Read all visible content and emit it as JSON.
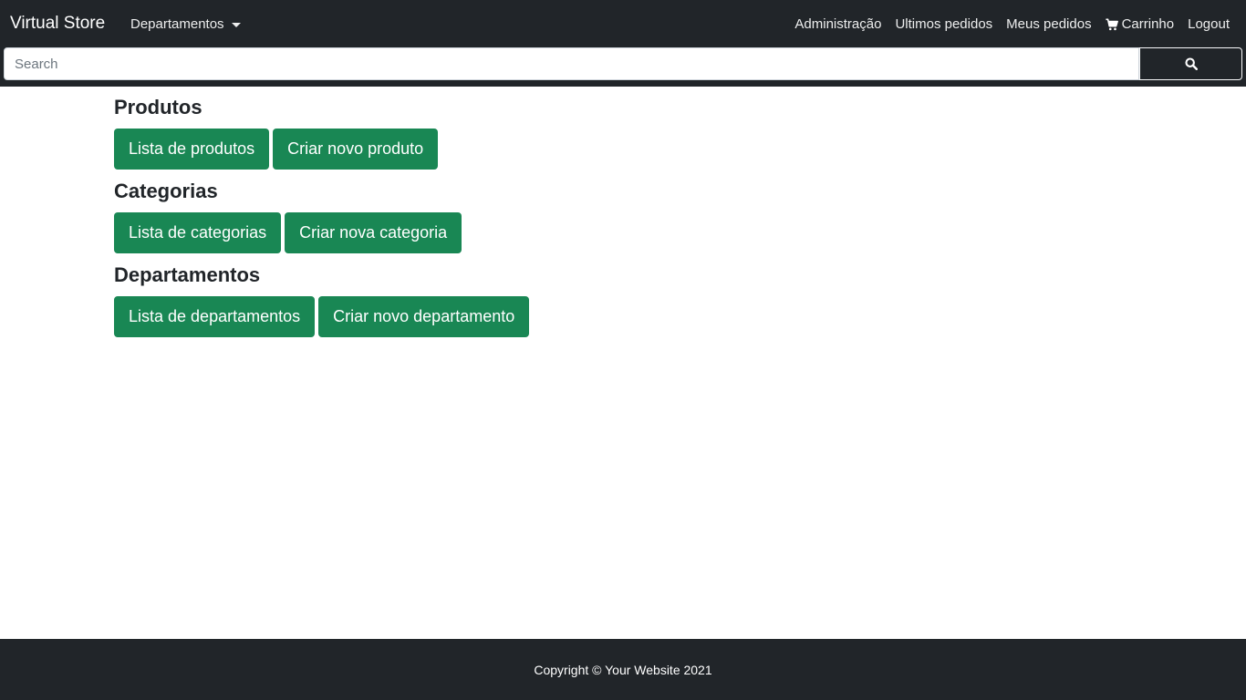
{
  "navbar": {
    "brand": "Virtual Store",
    "departments_dropdown": "Departamentos",
    "links": {
      "admin": "Administração",
      "last_orders": "Ultimos pedidos",
      "my_orders": "Meus pedidos",
      "cart": "Carrinho",
      "logout": "Logout"
    },
    "search": {
      "placeholder": "Search",
      "value": ""
    }
  },
  "sections": {
    "products": {
      "title": "Produtos",
      "list_button": "Lista de produtos",
      "create_button": "Criar novo produto"
    },
    "categories": {
      "title": "Categorias",
      "list_button": "Lista de categorias",
      "create_button": "Criar nova categoria"
    },
    "departments": {
      "title": "Departamentos",
      "list_button": "Lista de departamentos",
      "create_button": "Criar novo departamento"
    }
  },
  "footer": {
    "copyright": "Copyright © Your Website 2021"
  },
  "colors": {
    "navbar_bg": "#212529",
    "button_green": "#198754",
    "text_dark": "#212529"
  },
  "icons": {
    "cart": "shopping-cart-icon",
    "search": "search-icon",
    "dropdown": "caret-down-icon"
  }
}
